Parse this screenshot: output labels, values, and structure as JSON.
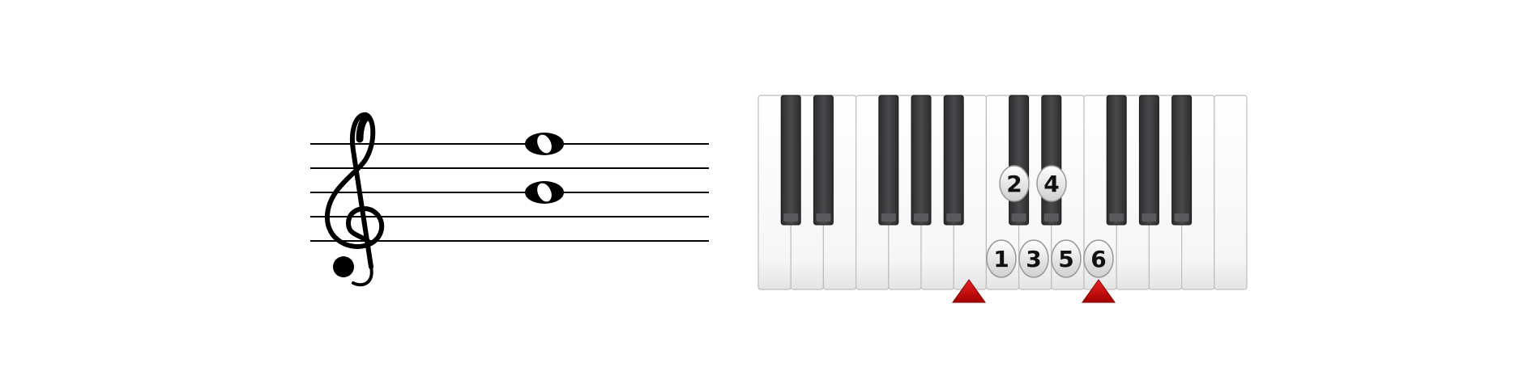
{
  "staff": {
    "clef": "treble-clef",
    "line_count": 5,
    "notes": [
      {
        "name": "whole-note",
        "pitch": "F5",
        "type": "whole"
      },
      {
        "name": "whole-note",
        "pitch": "B4",
        "type": "whole"
      }
    ]
  },
  "keyboard": {
    "white_key_count": 15,
    "black_key_count": 10,
    "fingering_top": [
      {
        "label": "2"
      },
      {
        "label": "4"
      }
    ],
    "fingering_bottom": [
      {
        "label": "1"
      },
      {
        "label": "3"
      },
      {
        "label": "5"
      },
      {
        "label": "6"
      }
    ],
    "markers": [
      {
        "name": "marker-triangle-1",
        "shape": "triangle-up"
      },
      {
        "name": "marker-triangle-2",
        "shape": "triangle-up"
      }
    ]
  },
  "colors": {
    "staff_line": "#000000",
    "note": "#000000",
    "black_key": "#3a3a3c",
    "white_key": "#ffffff",
    "white_key_border": "#bdbdbd",
    "finger_badge": "#e2e2e2",
    "marker": "#cc0000"
  }
}
